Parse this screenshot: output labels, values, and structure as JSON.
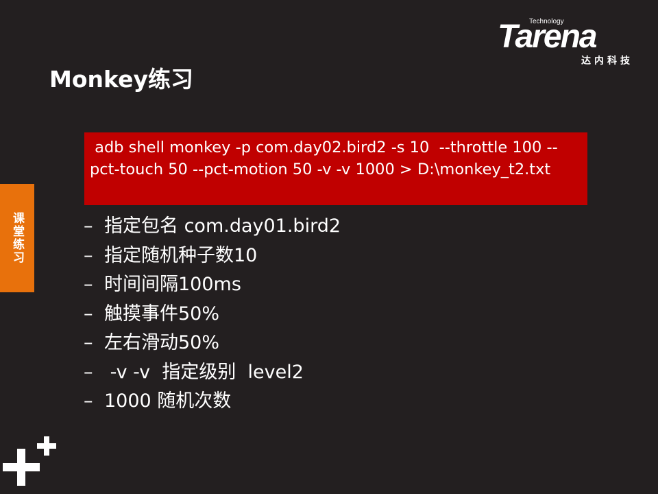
{
  "logo": {
    "tech": "Technology",
    "word": "Tarena",
    "cn": "达内科技"
  },
  "slide": {
    "title": "Monkey练习",
    "side_tab": "课堂练习",
    "command": " adb shell monkey -p com.day02.bird2 -s 10  --throttle 100 --pct-touch 50 --pct-motion 50 -v -v 1000 > D:\\monkey_t2.txt",
    "bullet_marker": "–",
    "items": [
      "指定包名 com.day01.bird2",
      "指定随机种子数10",
      "时间间隔100ms",
      "触摸事件50%",
      "左右滑动50%",
      " -v -v  指定级别  level2",
      "1000 随机次数"
    ]
  },
  "colors": {
    "background": "#231f20",
    "command_box": "#c00000",
    "side_tab": "#e8710c",
    "text": "#ffffff"
  }
}
